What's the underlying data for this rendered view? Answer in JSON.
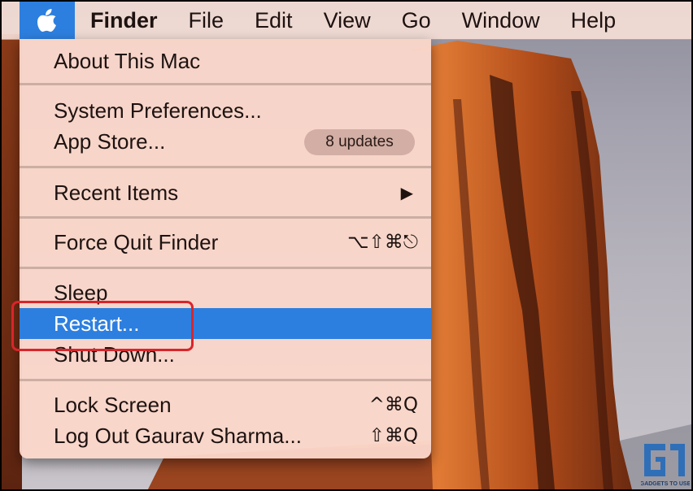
{
  "menubar": {
    "apple_icon": "apple-logo-icon",
    "items": [
      "Finder",
      "File",
      "Edit",
      "View",
      "Go",
      "Window",
      "Help"
    ],
    "highlight_color": "#2d7fdf"
  },
  "apple_menu": {
    "about": "About This Mac",
    "system_preferences": "System Preferences...",
    "app_store": "App Store...",
    "app_store_badge": "8 updates",
    "recent_items": "Recent Items",
    "recent_items_arrow": "▶",
    "force_quit": "Force Quit Finder",
    "force_quit_shortcut": "⌥⇧⌘⎋",
    "sleep": "Sleep",
    "restart": "Restart...",
    "shut_down": "Shut Down...",
    "lock_screen": "Lock Screen",
    "lock_screen_shortcut": "^⌘Q",
    "log_out": "Log Out Gaurav Sharma...",
    "log_out_shortcut": "⇧⌘Q",
    "highlighted_item": "Restart..."
  },
  "annotation": {
    "color": "#d9252b",
    "target": "Restart..."
  },
  "watermark": {
    "logo": "G",
    "text": "GADGETS TO USE"
  }
}
